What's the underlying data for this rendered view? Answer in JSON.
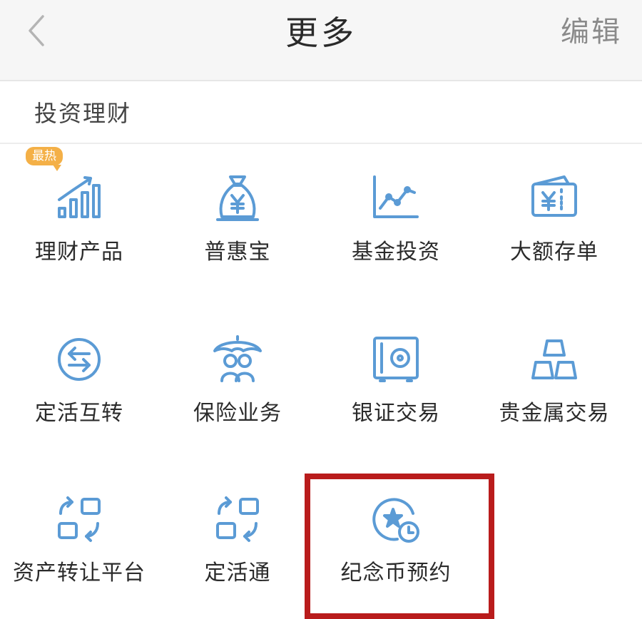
{
  "navbar": {
    "title": "更多",
    "edit_label": "编辑"
  },
  "section": {
    "title": "投资理财"
  },
  "badge": {
    "text": "最热"
  },
  "accent_color": "#5b9bd5",
  "highlight_color": "#b91c1c",
  "grid": {
    "items": [
      {
        "label": "理财产品",
        "icon": "bar-growth-icon"
      },
      {
        "label": "普惠宝",
        "icon": "money-bag-icon"
      },
      {
        "label": "基金投资",
        "icon": "line-chart-icon"
      },
      {
        "label": "大额存单",
        "icon": "deposit-certificate-icon"
      },
      {
        "label": "定活互转",
        "icon": "exchange-circle-icon"
      },
      {
        "label": "保险业务",
        "icon": "umbrella-family-icon"
      },
      {
        "label": "银证交易",
        "icon": "safe-icon"
      },
      {
        "label": "贵金属交易",
        "icon": "gold-bars-icon"
      },
      {
        "label": "资产转让平台",
        "icon": "transfer-squares-icon"
      },
      {
        "label": "定活通",
        "icon": "transfer-squares-icon"
      },
      {
        "label": "纪念币预约",
        "icon": "coin-clock-icon"
      }
    ]
  }
}
